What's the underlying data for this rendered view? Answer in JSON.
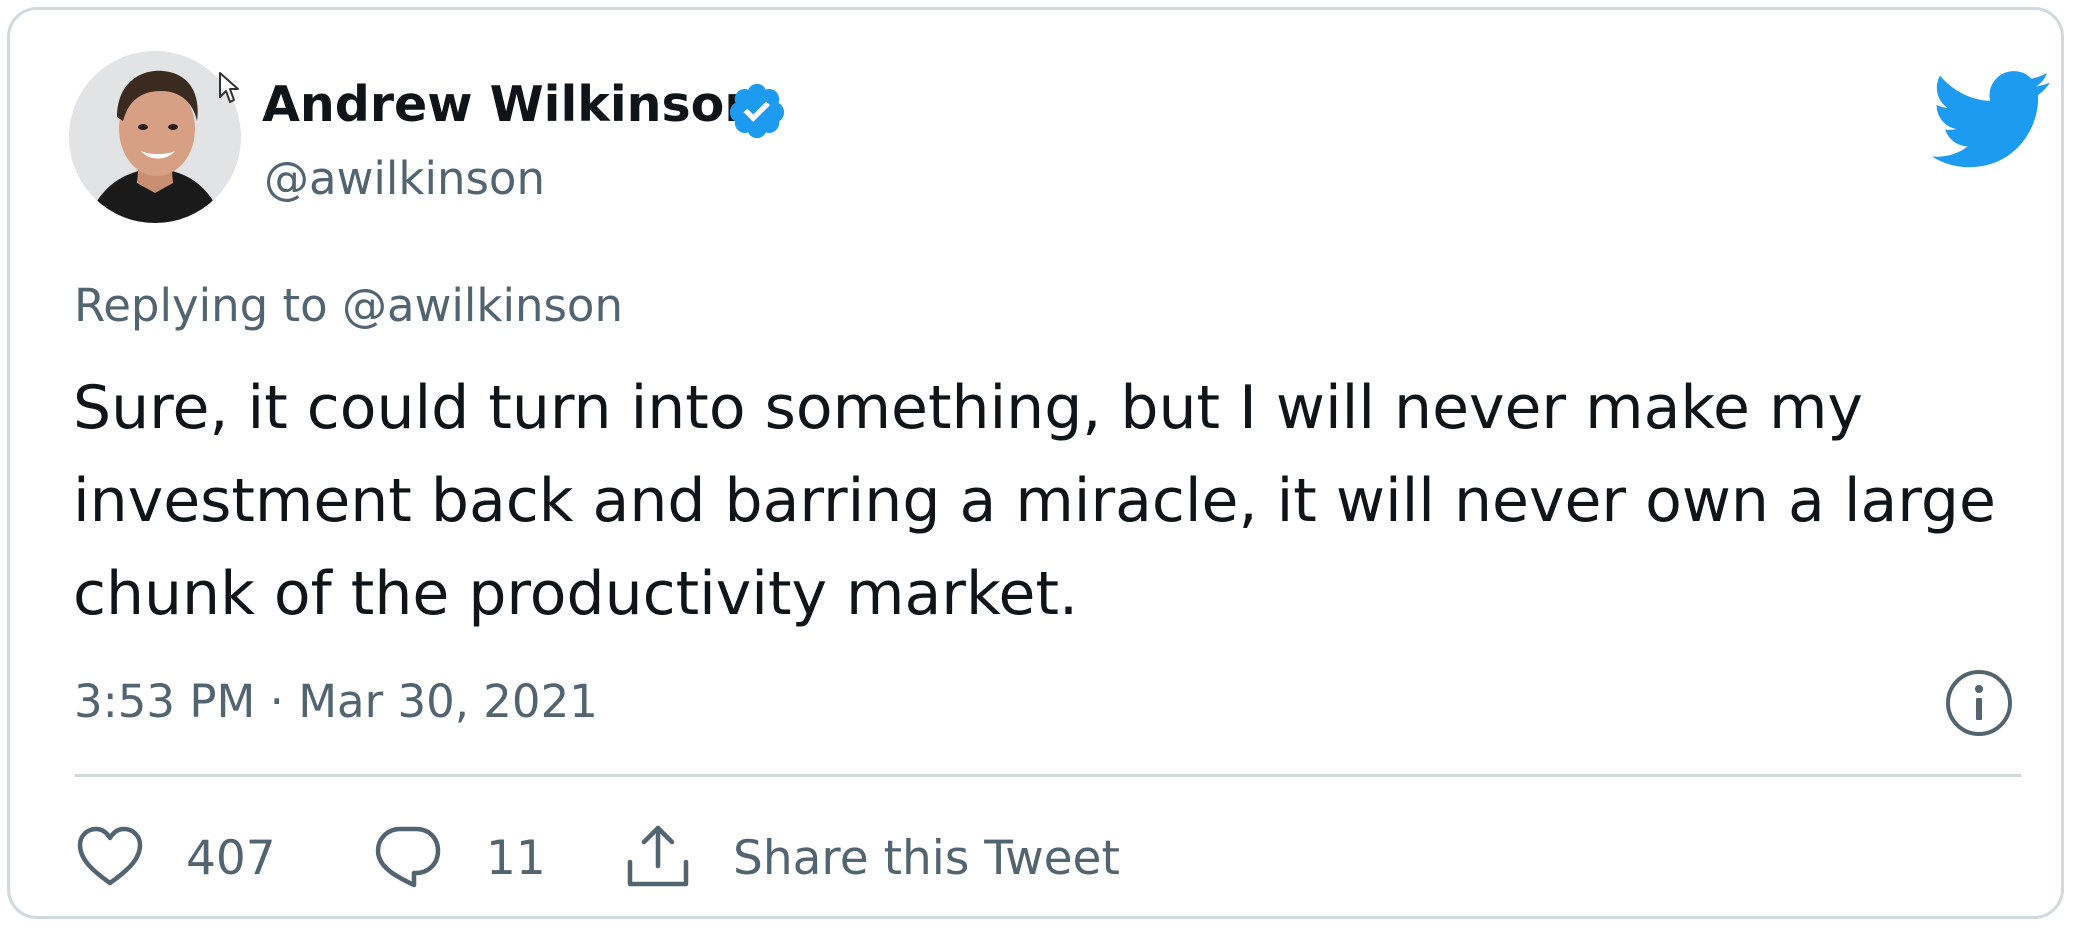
{
  "author": {
    "display_name": "Andrew Wilkinson",
    "handle": "@awilkinson",
    "verified": true
  },
  "reply_context": "Replying to @awilkinson",
  "tweet_text": "Sure, it could turn into something, but I will never make my investment back and barring a miracle, it will never own a large chunk of the productivity market.",
  "timestamp": "3:53 PM · Mar 30, 2021",
  "actions": {
    "like_count": "407",
    "reply_count": "11",
    "share_label": "Share this Tweet"
  },
  "icons": {
    "avatar": "avatar",
    "verified": "verified-badge-icon",
    "brand": "twitter-bird-icon",
    "info": "info-icon",
    "like": "heart-icon",
    "reply": "reply-bubble-icon",
    "share": "share-upload-icon"
  },
  "colors": {
    "brand": "#1d9bf0",
    "text_primary": "#0f1419",
    "text_secondary": "#536471",
    "border": "#cfd9de"
  }
}
